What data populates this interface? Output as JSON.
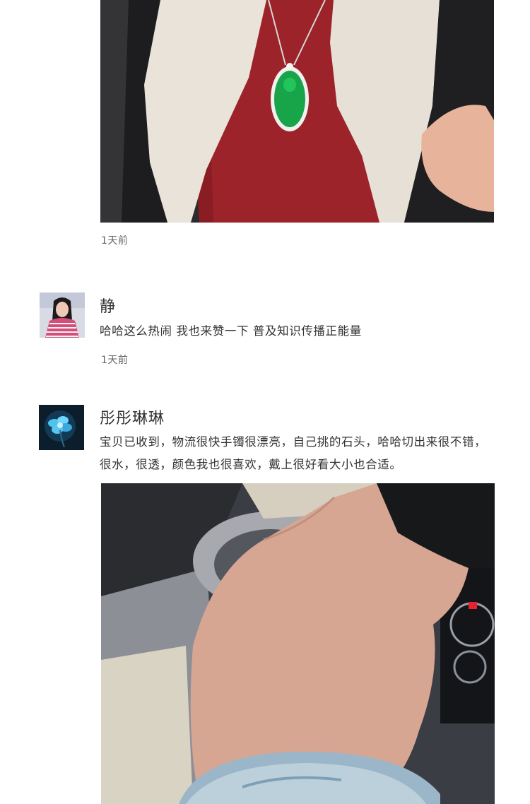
{
  "colors": {
    "background": "#ffffff",
    "text": "#333333",
    "time_text": "#666666"
  },
  "reviews": [
    {
      "photo_icon": "jade-pendant-photo",
      "time": "1天前"
    },
    {
      "username": "静",
      "avatar_icon": "user-avatar-girl",
      "text": "哈哈这么热闹 我也来赞一下 普及知识传播正能量",
      "time": "1天前"
    },
    {
      "username": "彤彤琳琳",
      "avatar_icon": "user-avatar-blue-flower",
      "text_lines": [
        "宝贝已收到，物流很快手镯很漂亮，自己挑的石头，哈哈切出来很不错，",
        "很水，很透，颜色我也很喜欢，戴上很好看大小也合适。"
      ],
      "photo_icon": "jade-bangle-photo"
    }
  ]
}
